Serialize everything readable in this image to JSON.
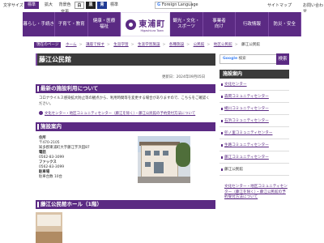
{
  "utility": {
    "font_size_label": "文字サイズ",
    "standard": "標準",
    "enlarge": "拡大",
    "bg_color_label": "背景色変更",
    "color_white": "白",
    "color_black": "黒",
    "color_blue": "青",
    "color_standard": "標準",
    "foreign_language": "Foreign Language",
    "sitemap": "サイトマップ",
    "contact": "お問い合わせ"
  },
  "gnav": {
    "items": [
      "暮らし・手続き",
      "子育て・教育",
      "健康・医療\n福祉",
      "観光・文化・\nスポーツ",
      "事業者\n向け",
      "行政情報",
      "防災・安全"
    ],
    "logo_jp": "東浦町",
    "logo_en": "Higashiura Town"
  },
  "breadcrumb": {
    "current_label": "現在のページ",
    "items": [
      "ホーム",
      "講座で探す",
      "生涯学習",
      "生涯学習施設",
      "各種施設",
      "公民館",
      "地区公民館",
      "藤江公民館"
    ]
  },
  "page": {
    "title": "藤江公民館",
    "updated": "更新日：2024年09月05日"
  },
  "notice": {
    "heading": "最新の施設利用について",
    "text": "コロナウイルス感染拡大防止等の観点から、利用時間等を変更する場合がありますので、こちらをご確認ください。",
    "link": "文化センター・地区コミュニティセンター（藤江を除く）・藤江公民館の予約受付方法について"
  },
  "facility": {
    "heading": "施設案内",
    "address_label": "住所",
    "address": "〒470-2105\n知多郡東浦町大字藤江字浜田87",
    "phone_label": "電話",
    "phone": "0562-83-3099",
    "fax_label": "ファックス",
    "fax": "0562-83-3099",
    "parking_label": "駐車場",
    "parking": "駐車台数 10台"
  },
  "hall": {
    "heading": "藤江公民館ホール（1階）"
  },
  "search": {
    "google_label": "Google",
    "placeholder": "検索",
    "button": "検索"
  },
  "sidebar": {
    "heading": "施設案内",
    "items": [
      "文化センター",
      "森岡コミュニティセンター",
      "緒川コミュニティセンター",
      "石浜コミュニティセンター",
      "卯ノ里コミュニティセンター",
      "生路コミュニティセンター",
      "藤江コミュニティセンター",
      "藤江公民館"
    ],
    "sub_link": "文化センター・地区コミュニティセンター（藤江を除く）・藤江公民館の予約受付方法について"
  },
  "colors": {
    "brand": "#5b2a83",
    "title_bar": "#3a3a3a"
  }
}
